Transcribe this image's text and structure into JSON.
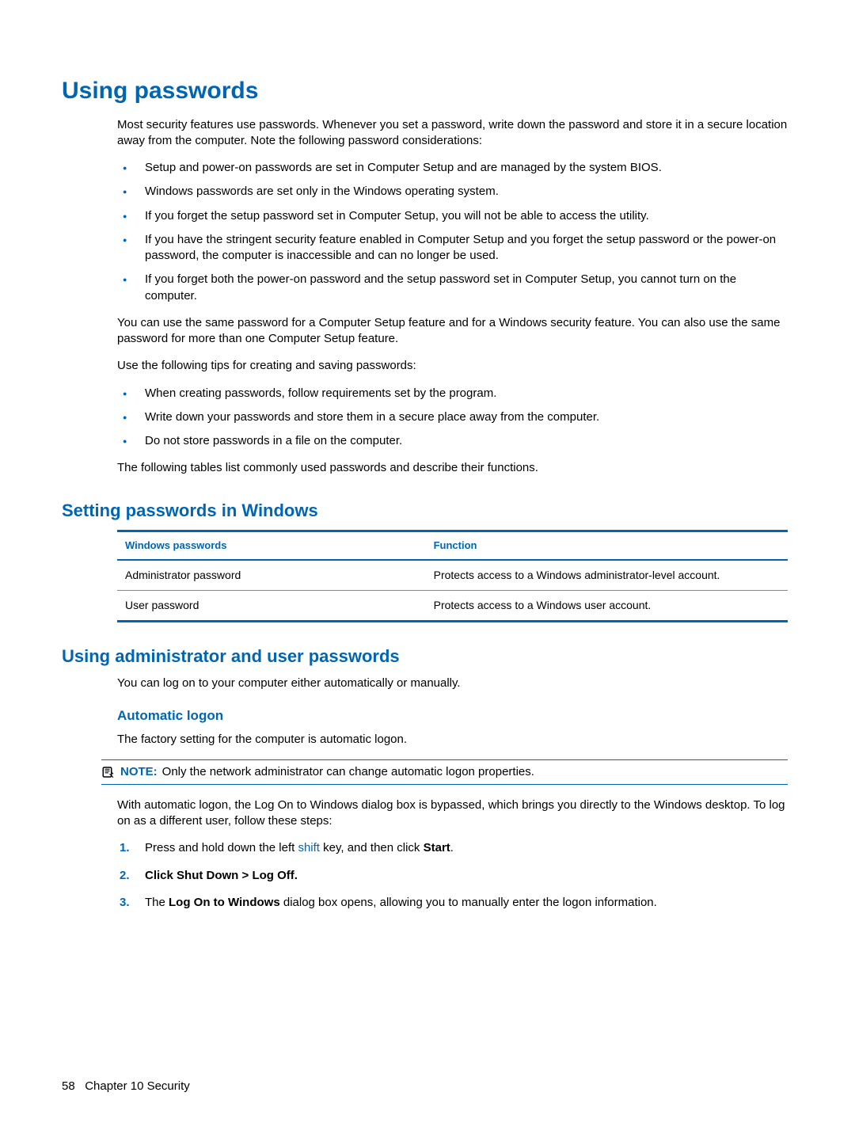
{
  "heading1": "Using passwords",
  "intro": "Most security features use passwords. Whenever you set a password, write down the password and store it in a secure location away from the computer. Note the following password considerations:",
  "bullets1": [
    "Setup and power-on passwords are set in Computer Setup and are managed by the system BIOS.",
    "Windows passwords are set only in the Windows operating system.",
    "If you forget the setup password set in Computer Setup, you will not be able to access the utility.",
    "If you have the stringent security feature enabled in Computer Setup and you forget the setup password or the power-on password, the computer is inaccessible and can no longer be used.",
    "If you forget both the power-on password and the setup password set in Computer Setup, you cannot turn on the computer."
  ],
  "para_same": "You can use the same password for a Computer Setup feature and for a Windows security feature. You can also use the same password for more than one Computer Setup feature.",
  "para_tips": "Use the following tips for creating and saving passwords:",
  "bullets2": [
    "When creating passwords, follow requirements set by the program.",
    "Write down your passwords and store them in a secure place away from the computer.",
    "Do not store passwords in a file on the computer."
  ],
  "para_tables": "The following tables list commonly used passwords and describe their functions.",
  "heading2": "Setting passwords in Windows",
  "table": {
    "h1": "Windows passwords",
    "h2": "Function",
    "rows": [
      {
        "c1": "Administrator password",
        "c2": "Protects access to a Windows administrator-level account."
      },
      {
        "c1": "User password",
        "c2": "Protects access to a Windows user account."
      }
    ]
  },
  "heading3": "Using administrator and user passwords",
  "para_logon": "You can log on to your computer either automatically or manually.",
  "heading4": "Automatic logon",
  "para_factory": "The factory setting for the computer is automatic logon.",
  "note": {
    "label": "NOTE:",
    "text": "Only the network administrator can change automatic logon properties."
  },
  "para_auto": "With automatic logon, the Log On to Windows dialog box is bypassed, which brings you directly to the Windows desktop. To log on as a different user, follow these steps:",
  "steps": {
    "s1_a": "Press and hold down the left ",
    "s1_link": "shift",
    "s1_b": " key, and then click ",
    "s1_bold": "Start",
    "s1_c": ".",
    "s2_a": "Click ",
    "s2_bold": "Shut Down > Log Off",
    "s2_b": ".",
    "s3_a": "The ",
    "s3_bold": "Log On to Windows",
    "s3_b": " dialog box opens, allowing you to manually enter the logon information."
  },
  "footer": {
    "pagenum": "58",
    "chapter": "Chapter 10   Security"
  }
}
